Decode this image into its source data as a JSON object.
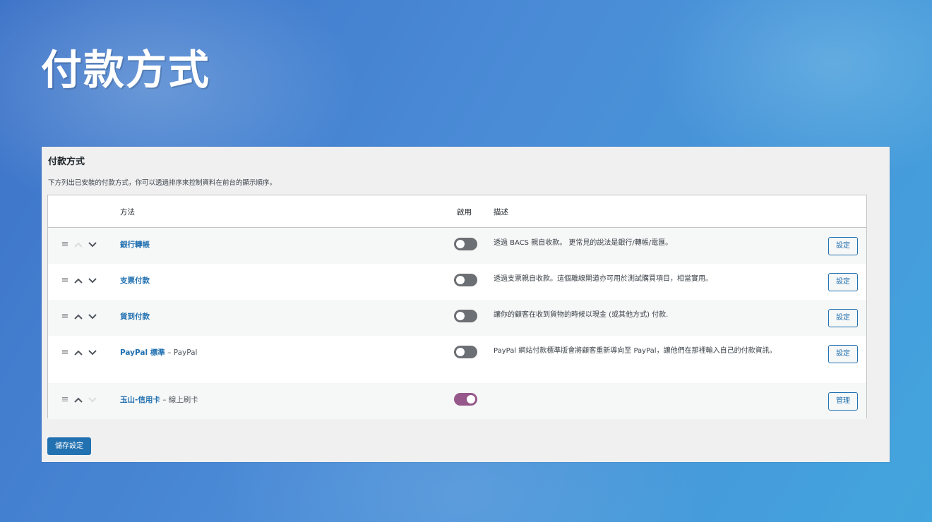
{
  "hero": {
    "title": "付款方式"
  },
  "panel": {
    "heading": "付款方式",
    "description": "下方列出已安裝的付款方式，你可以透過排序來控制資料在前台的顯示順序。",
    "columns": {
      "method": "方法",
      "enabled": "啟用",
      "description": "描述"
    },
    "gateways": [
      {
        "name": "銀行轉帳",
        "suffix": "",
        "enabled": false,
        "description": "透過 BACS 親自收款。 更常見的說法是銀行/轉帳/電匯。",
        "action": "設定",
        "up_disabled": true,
        "down_disabled": false
      },
      {
        "name": "支票付款",
        "suffix": "",
        "enabled": false,
        "description": "透過支票親自收款。這個離線閘道亦可用於測試購買項目，相當實用。",
        "action": "設定",
        "up_disabled": false,
        "down_disabled": false
      },
      {
        "name": "貨到付款",
        "suffix": "",
        "enabled": false,
        "description": "讓你的顧客在收到貨物的時候以現金 (或其他方式) 付款.",
        "action": "設定",
        "up_disabled": false,
        "down_disabled": false
      },
      {
        "name": "PayPal 標準",
        "suffix": " – PayPal",
        "enabled": false,
        "description": "PayPal 網站付款標準版會將顧客重新導向至 PayPal，讓他們在那裡輸入自己的付款資訊。",
        "action": "設定",
        "up_disabled": false,
        "down_disabled": false
      },
      {
        "name": "玉山-信用卡",
        "suffix": " – 線上刷卡",
        "enabled": true,
        "description": "",
        "action": "管理",
        "up_disabled": false,
        "down_disabled": true
      }
    ],
    "save_label": "儲存設定"
  },
  "colors": {
    "accent": "#2271b1",
    "toggle_on": "#96588a",
    "toggle_off": "#6c6f73"
  },
  "icons": {
    "drag": "menu-icon",
    "up": "chevron-up-icon",
    "down": "chevron-down-icon"
  }
}
